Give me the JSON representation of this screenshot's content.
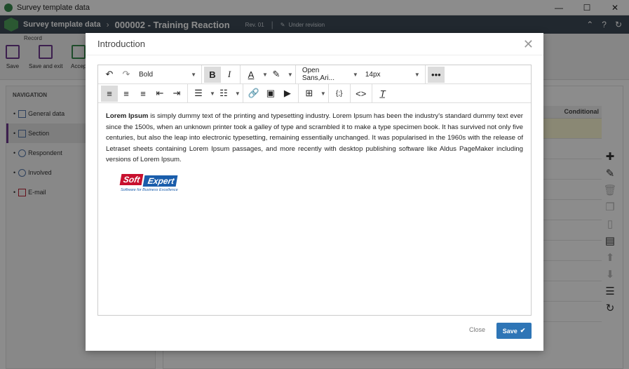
{
  "window": {
    "title": "Survey template data",
    "controls": [
      "—",
      "☐",
      "✕"
    ]
  },
  "header": {
    "crumb": "Survey template data",
    "doc_title": "000002 - Training Reaction",
    "revision": "Rev. 01",
    "status": "Under revision",
    "right_icons": [
      "chevron-double-up-icon",
      "help-icon",
      "refresh-icon"
    ]
  },
  "ribbon": {
    "group_label": "Record",
    "buttons": [
      {
        "label": "Save"
      },
      {
        "label": "Save and exit"
      },
      {
        "label": "Accep"
      }
    ]
  },
  "navigation": {
    "title": "NAVIGATION",
    "items": [
      {
        "label": "General data",
        "active": false
      },
      {
        "label": "Section",
        "active": true
      },
      {
        "label": "Respondent",
        "active": false
      },
      {
        "label": "Involved",
        "active": false
      },
      {
        "label": "E-mail",
        "active": false
      }
    ]
  },
  "grid": {
    "column_conditional": "Conditional"
  },
  "modal": {
    "title": "Introduction",
    "close_symbol": "✕",
    "toolbar": {
      "style_value": "Bold",
      "font_value": "Open Sans,Ari...",
      "size_value": "14px"
    },
    "content": {
      "bold_lead": "Lorem Ipsum",
      "text": " is simply dummy text of the printing and typesetting industry. Lorem Ipsum has been the industry's standard dummy text ever since the 1500s, when an unknown printer took a galley of type and scrambled it to make a type specimen book. It has survived not only five centuries, but also the leap into electronic typesetting, remaining essentially unchanged. It was popularised in the 1960s with the release of Letraset sheets containing Lorem Ipsum passages, and more recently with desktop publishing software like Aldus PageMaker including versions of Lorem Ipsum."
    },
    "logo": {
      "word1": "Soft",
      "word2": "Expert",
      "tagline": "Software for Business Excellence"
    },
    "footer": {
      "close_label": "Close",
      "save_label": "Save"
    }
  }
}
